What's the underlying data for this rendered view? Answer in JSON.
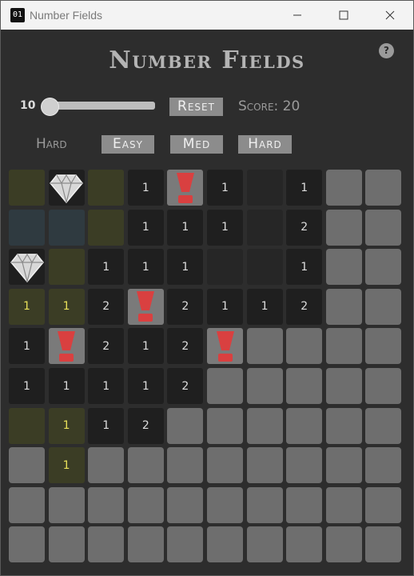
{
  "window": {
    "icon_text": "01",
    "title": "Number Fields"
  },
  "header": {
    "title": "Number Fields",
    "help": "?"
  },
  "controls": {
    "size_value": "10",
    "size_slider_level": 0,
    "reset_label": "Reset",
    "score_text": "Score: 20",
    "mode_label": "Hard",
    "easy_label": "Easy",
    "med_label": "Med",
    "hard_label": "Hard"
  },
  "board": {
    "cols": 10,
    "rows": 10,
    "legend": {
      "#": "covered",
      ".": "revealed empty",
      "D": "diamond",
      "!": "flag",
      "o": "olive tile",
      "s": "slate tile"
    },
    "grid": [
      [
        "o",
        "D",
        "o",
        "1",
        "!",
        "1",
        ".",
        "1",
        "#",
        "#"
      ],
      [
        "s",
        "s",
        "o",
        "1",
        "1",
        "1",
        ".",
        "2",
        "#",
        "#"
      ],
      [
        "D",
        "o",
        "1",
        "1",
        "1",
        ".",
        ".",
        "1",
        "#",
        "#"
      ],
      [
        "1*",
        "1*",
        "2",
        "!",
        "2",
        "1",
        "1",
        "2",
        "#",
        "#"
      ],
      [
        "1",
        "!",
        "2",
        "1",
        "2",
        "!",
        "#",
        "#",
        "#",
        "#"
      ],
      [
        "1",
        "1",
        "1",
        "1",
        "2",
        "#",
        "#",
        "#",
        "#",
        "#"
      ],
      [
        "o",
        "1*",
        "1",
        "2",
        "#",
        "#",
        "#",
        "#",
        "#",
        "#"
      ],
      [
        "#",
        "1*",
        "#",
        "#",
        "#",
        "#",
        "#",
        "#",
        "#",
        "#"
      ],
      [
        "#",
        "#",
        "#",
        "#",
        "#",
        "#",
        "#",
        "#",
        "#",
        "#"
      ],
      [
        "#",
        "#",
        "#",
        "#",
        "#",
        "#",
        "#",
        "#",
        "#",
        "#"
      ]
    ]
  },
  "colors": {
    "background": "#2d2d2d",
    "covered": "#6e6e6e",
    "revealed": "#1f1f1f",
    "highlight_number": "#e8e05a",
    "flag": "#d94040",
    "button": "#8c8c8c"
  }
}
